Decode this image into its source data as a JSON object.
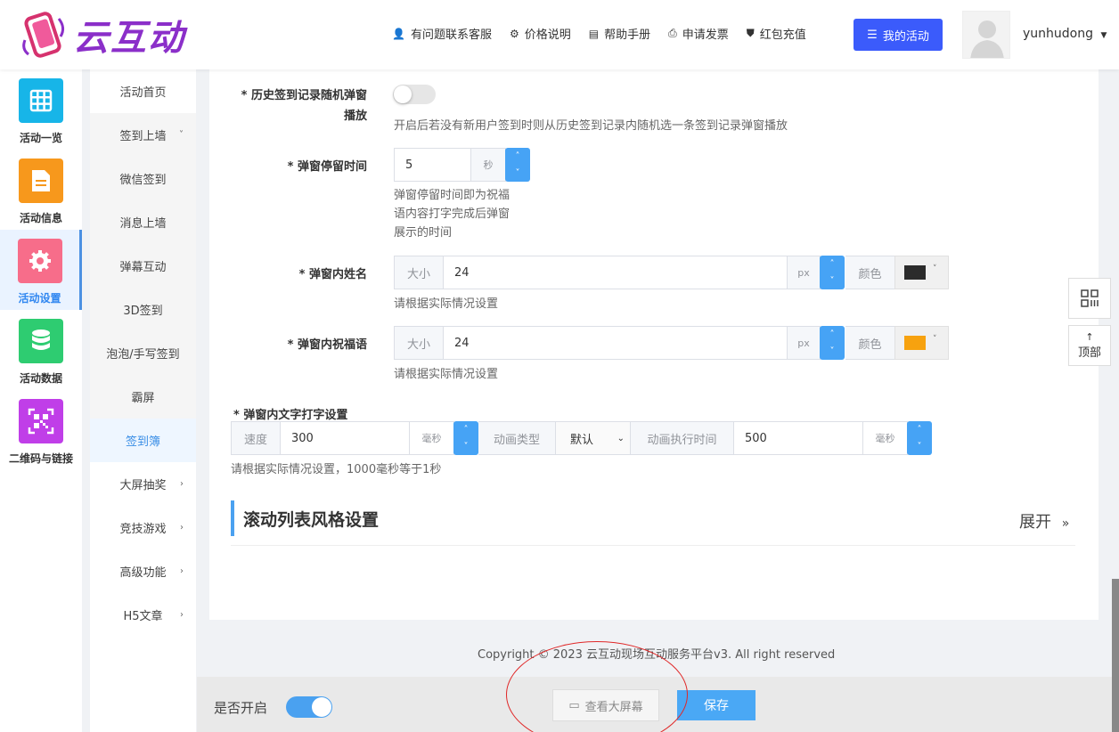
{
  "header": {
    "brand": "云互动",
    "nav": [
      {
        "icon": "user-plus-icon",
        "glyph": "👤",
        "label": "有问题联系客服"
      },
      {
        "icon": "gear-icon",
        "glyph": "⚙",
        "label": "价格说明"
      },
      {
        "icon": "book-icon",
        "glyph": "▤",
        "label": "帮助手册"
      },
      {
        "icon": "printer-icon",
        "glyph": "⎙",
        "label": "申请发票"
      },
      {
        "icon": "shield-check-icon",
        "glyph": "⛊",
        "label": "红包充值"
      }
    ],
    "my_activity": "我的活动",
    "username": "yunhudong"
  },
  "sidebar": {
    "items": [
      {
        "label": "活动一览",
        "icon": "grid-icon",
        "color": "#17b5e8"
      },
      {
        "label": "活动信息",
        "icon": "document-icon",
        "color": "#f7981c"
      },
      {
        "label": "活动设置",
        "icon": "settings-icon",
        "color": "#f76d8a"
      },
      {
        "label": "活动数据",
        "icon": "database-icon",
        "color": "#2ecc71"
      },
      {
        "label": "二维码与链接",
        "icon": "qrcode-icon",
        "color": "#c03ee8"
      }
    ]
  },
  "subnav": {
    "items": [
      {
        "label": "活动首页"
      },
      {
        "label": "签到上墙",
        "arrow": "˅"
      },
      {
        "label": "微信签到"
      },
      {
        "label": "消息上墙"
      },
      {
        "label": "弹幕互动"
      },
      {
        "label": "3D签到"
      },
      {
        "label": "泡泡/手写签到"
      },
      {
        "label": "霸屏"
      },
      {
        "label": "签到簿"
      },
      {
        "label": "大屏抽奖",
        "arrow": "›"
      },
      {
        "label": "竞技游戏",
        "arrow": "›"
      },
      {
        "label": "高级功能",
        "arrow": "›"
      },
      {
        "label": "H5文章",
        "arrow": "›"
      }
    ]
  },
  "form": {
    "history_label_1": "* 历史签到记录随机弹窗",
    "history_label_2": "播放",
    "history_help": "开启后若没有新用户签到时则从历史签到记录内随机选一条签到记录弹窗播放",
    "stay_label": "* 弹窗停留时间",
    "stay_value": "5",
    "stay_unit": "秒",
    "stay_help_1": "弹窗停留时间即为祝福",
    "stay_help_2": "语内容打字完成后弹窗",
    "stay_help_3": "展示的时间",
    "name_label": "* 弹窗内姓名",
    "size_label": "大小",
    "name_size": "24",
    "px": "px",
    "color_label": "颜色",
    "name_color": "#2b2b2b",
    "name_help": "请根据实际情况设置",
    "bless_label": "* 弹窗内祝福语",
    "bless_size": "24",
    "bless_color": "#f7a20f",
    "bless_help": "请根据实际情况设置",
    "typing_label": "* 弹窗内文字打字设置",
    "speed_label": "速度",
    "speed_value": "300",
    "ms": "毫秒",
    "anim_type_label": "动画类型",
    "anim_type_value": "默认",
    "anim_time_label": "动画执行时间",
    "anim_time_value": "500",
    "typing_help": "请根据实际情况设置，1000毫秒等于1秒"
  },
  "section": {
    "title": "滚动列表风格设置",
    "expand": "展开"
  },
  "footer": {
    "copyright": "Copyright © 2023 云互动现场互动服务平台v3. All right reserved"
  },
  "bottombar": {
    "enable_label": "是否开启",
    "view_screen": "查看大屏幕",
    "save": "保存"
  },
  "floating": {
    "top_label": "顶部",
    "top_arrow": "↑"
  }
}
